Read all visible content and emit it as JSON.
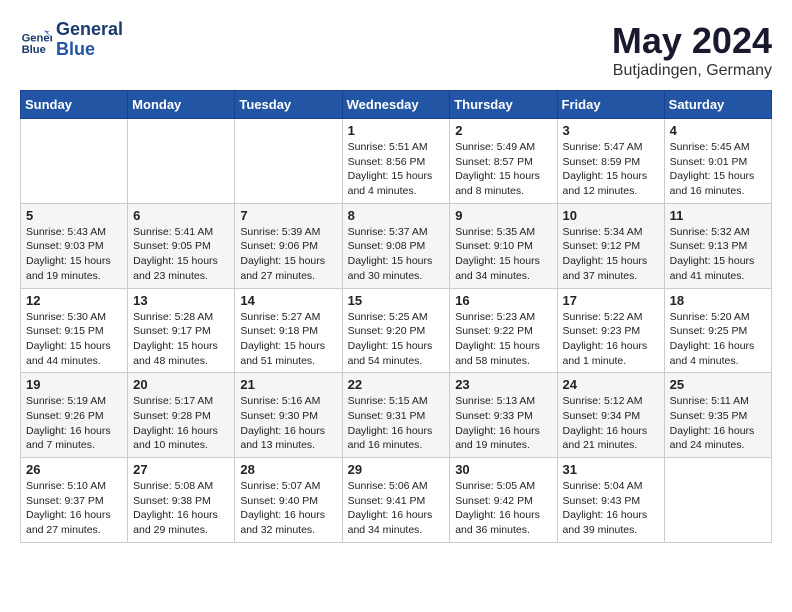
{
  "header": {
    "logo_line1": "General",
    "logo_line2": "Blue",
    "month": "May 2024",
    "location": "Butjadingen, Germany"
  },
  "weekdays": [
    "Sunday",
    "Monday",
    "Tuesday",
    "Wednesday",
    "Thursday",
    "Friday",
    "Saturday"
  ],
  "weeks": [
    [
      {
        "day": "",
        "info": ""
      },
      {
        "day": "",
        "info": ""
      },
      {
        "day": "",
        "info": ""
      },
      {
        "day": "1",
        "info": "Sunrise: 5:51 AM\nSunset: 8:56 PM\nDaylight: 15 hours\nand 4 minutes."
      },
      {
        "day": "2",
        "info": "Sunrise: 5:49 AM\nSunset: 8:57 PM\nDaylight: 15 hours\nand 8 minutes."
      },
      {
        "day": "3",
        "info": "Sunrise: 5:47 AM\nSunset: 8:59 PM\nDaylight: 15 hours\nand 12 minutes."
      },
      {
        "day": "4",
        "info": "Sunrise: 5:45 AM\nSunset: 9:01 PM\nDaylight: 15 hours\nand 16 minutes."
      }
    ],
    [
      {
        "day": "5",
        "info": "Sunrise: 5:43 AM\nSunset: 9:03 PM\nDaylight: 15 hours\nand 19 minutes."
      },
      {
        "day": "6",
        "info": "Sunrise: 5:41 AM\nSunset: 9:05 PM\nDaylight: 15 hours\nand 23 minutes."
      },
      {
        "day": "7",
        "info": "Sunrise: 5:39 AM\nSunset: 9:06 PM\nDaylight: 15 hours\nand 27 minutes."
      },
      {
        "day": "8",
        "info": "Sunrise: 5:37 AM\nSunset: 9:08 PM\nDaylight: 15 hours\nand 30 minutes."
      },
      {
        "day": "9",
        "info": "Sunrise: 5:35 AM\nSunset: 9:10 PM\nDaylight: 15 hours\nand 34 minutes."
      },
      {
        "day": "10",
        "info": "Sunrise: 5:34 AM\nSunset: 9:12 PM\nDaylight: 15 hours\nand 37 minutes."
      },
      {
        "day": "11",
        "info": "Sunrise: 5:32 AM\nSunset: 9:13 PM\nDaylight: 15 hours\nand 41 minutes."
      }
    ],
    [
      {
        "day": "12",
        "info": "Sunrise: 5:30 AM\nSunset: 9:15 PM\nDaylight: 15 hours\nand 44 minutes."
      },
      {
        "day": "13",
        "info": "Sunrise: 5:28 AM\nSunset: 9:17 PM\nDaylight: 15 hours\nand 48 minutes."
      },
      {
        "day": "14",
        "info": "Sunrise: 5:27 AM\nSunset: 9:18 PM\nDaylight: 15 hours\nand 51 minutes."
      },
      {
        "day": "15",
        "info": "Sunrise: 5:25 AM\nSunset: 9:20 PM\nDaylight: 15 hours\nand 54 minutes."
      },
      {
        "day": "16",
        "info": "Sunrise: 5:23 AM\nSunset: 9:22 PM\nDaylight: 15 hours\nand 58 minutes."
      },
      {
        "day": "17",
        "info": "Sunrise: 5:22 AM\nSunset: 9:23 PM\nDaylight: 16 hours\nand 1 minute."
      },
      {
        "day": "18",
        "info": "Sunrise: 5:20 AM\nSunset: 9:25 PM\nDaylight: 16 hours\nand 4 minutes."
      }
    ],
    [
      {
        "day": "19",
        "info": "Sunrise: 5:19 AM\nSunset: 9:26 PM\nDaylight: 16 hours\nand 7 minutes."
      },
      {
        "day": "20",
        "info": "Sunrise: 5:17 AM\nSunset: 9:28 PM\nDaylight: 16 hours\nand 10 minutes."
      },
      {
        "day": "21",
        "info": "Sunrise: 5:16 AM\nSunset: 9:30 PM\nDaylight: 16 hours\nand 13 minutes."
      },
      {
        "day": "22",
        "info": "Sunrise: 5:15 AM\nSunset: 9:31 PM\nDaylight: 16 hours\nand 16 minutes."
      },
      {
        "day": "23",
        "info": "Sunrise: 5:13 AM\nSunset: 9:33 PM\nDaylight: 16 hours\nand 19 minutes."
      },
      {
        "day": "24",
        "info": "Sunrise: 5:12 AM\nSunset: 9:34 PM\nDaylight: 16 hours\nand 21 minutes."
      },
      {
        "day": "25",
        "info": "Sunrise: 5:11 AM\nSunset: 9:35 PM\nDaylight: 16 hours\nand 24 minutes."
      }
    ],
    [
      {
        "day": "26",
        "info": "Sunrise: 5:10 AM\nSunset: 9:37 PM\nDaylight: 16 hours\nand 27 minutes."
      },
      {
        "day": "27",
        "info": "Sunrise: 5:08 AM\nSunset: 9:38 PM\nDaylight: 16 hours\nand 29 minutes."
      },
      {
        "day": "28",
        "info": "Sunrise: 5:07 AM\nSunset: 9:40 PM\nDaylight: 16 hours\nand 32 minutes."
      },
      {
        "day": "29",
        "info": "Sunrise: 5:06 AM\nSunset: 9:41 PM\nDaylight: 16 hours\nand 34 minutes."
      },
      {
        "day": "30",
        "info": "Sunrise: 5:05 AM\nSunset: 9:42 PM\nDaylight: 16 hours\nand 36 minutes."
      },
      {
        "day": "31",
        "info": "Sunrise: 5:04 AM\nSunset: 9:43 PM\nDaylight: 16 hours\nand 39 minutes."
      },
      {
        "day": "",
        "info": ""
      }
    ]
  ]
}
